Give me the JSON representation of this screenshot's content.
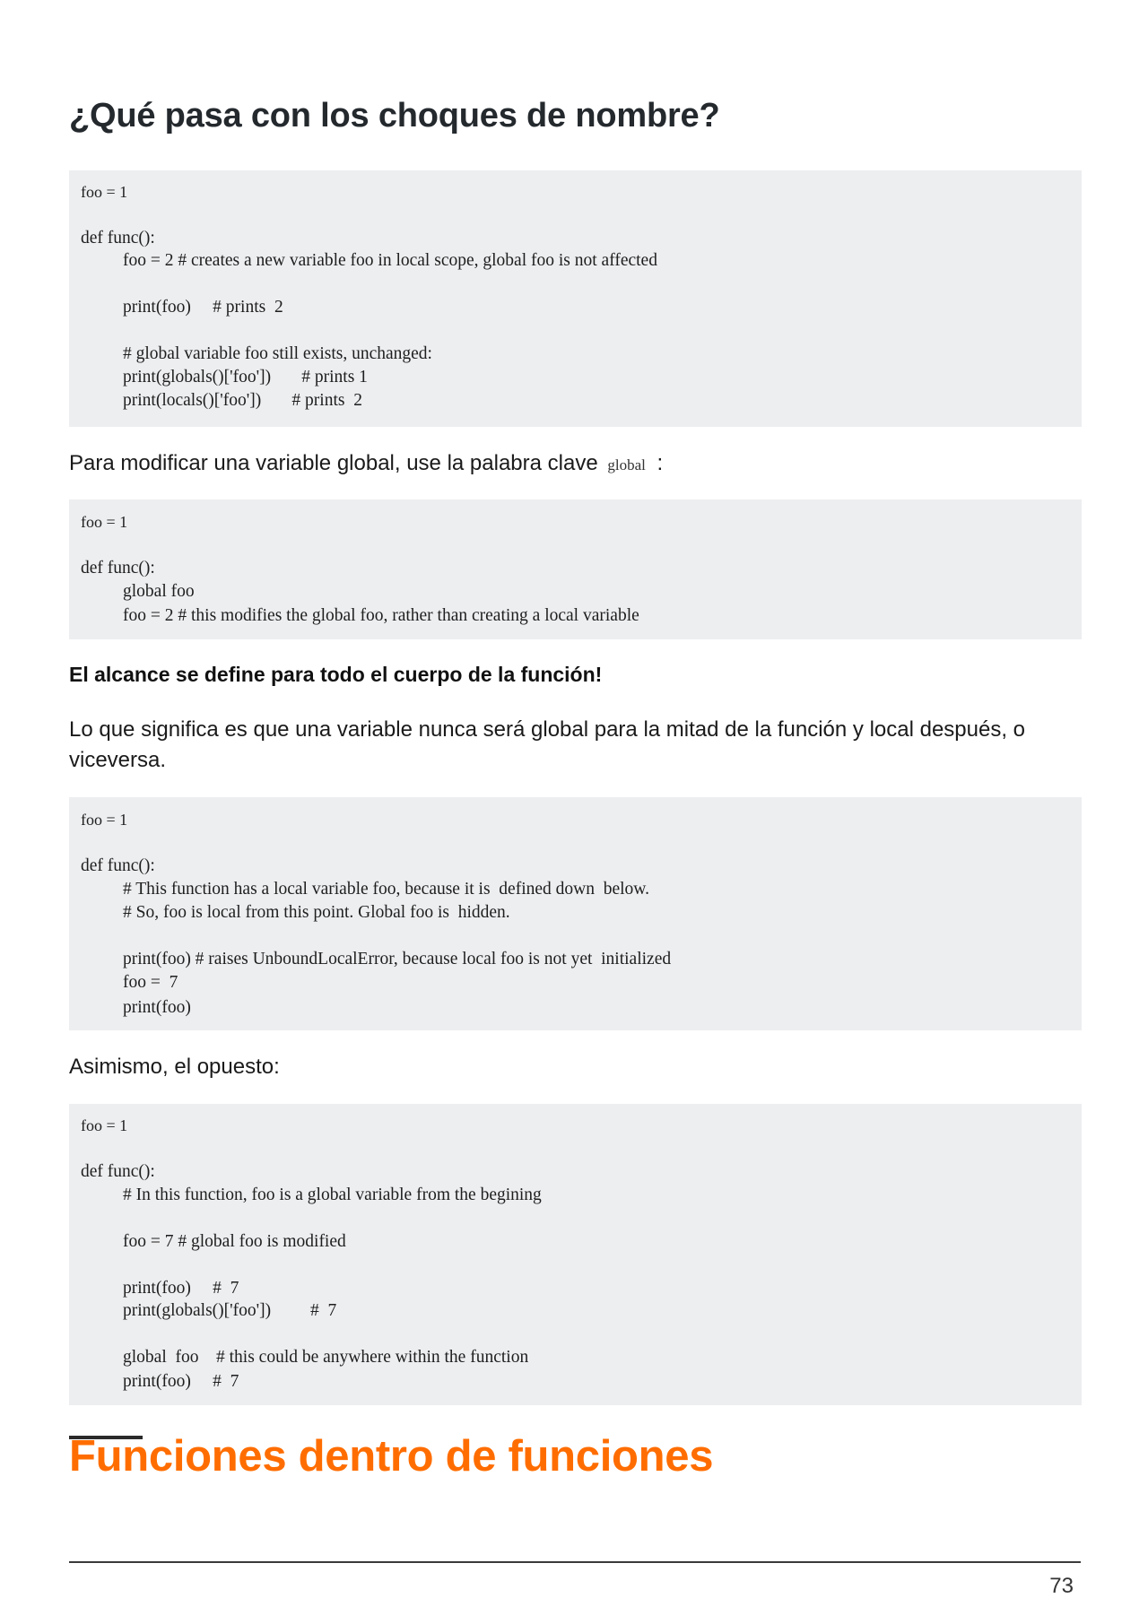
{
  "section_heading": "¿Qué pasa con los choques de nombre?",
  "code_blocks": [
    {
      "lines": [
        "foo = 1",
        "def func():",
        "foo = 2 # creates a new variable foo in local scope, global foo is not affected",
        "print(foo)     # prints  2",
        "# global variable foo still exists, unchanged:",
        "print(globals()['foo'])       # prints 1",
        "print(locals()['foo'])       # prints  2"
      ]
    },
    {
      "lines": [
        "foo = 1",
        "def func():",
        "global foo",
        "foo = 2 # this modifies the global foo, rather than creating a local variable"
      ]
    },
    {
      "lines": [
        "foo = 1",
        "def func():",
        "# This function has a local variable foo, because it is  defined down  below.",
        "# So, foo is local from this point. Global foo is  hidden.",
        "print(foo) # raises UnboundLocalError, because local foo is not yet  initialized",
        "foo =  7",
        "print(foo)"
      ]
    },
    {
      "lines": [
        "foo = 1",
        "def func():",
        "# In this function, foo is a global variable from the begining",
        "foo = 7 # global foo is modified",
        "print(foo)     #  7",
        "print(globals()['foo'])         #  7",
        "global  foo    # this could be anywhere within the function",
        "print(foo)     #  7"
      ]
    }
  ],
  "paragraphs": {
    "modify_global_prefix": "Para modificar una variable global, use la palabra clave",
    "modify_global_keyword": "global",
    "modify_global_suffix": ":",
    "scope_bold": "El alcance se define para todo el cuerpo de la función!",
    "scope_explanation": "Lo que significa es que una variable nunca será global para la mitad de la función y local después, o viceversa.",
    "opposite": "Asimismo, el opuesto:"
  },
  "chapter_heading": "Funciones dentro de funciones",
  "footer": {
    "page_number": "73"
  },
  "colors": {
    "chapter_heading": "#ff6d00",
    "code_background": "#edeef0",
    "section_heading": "#24292e"
  }
}
